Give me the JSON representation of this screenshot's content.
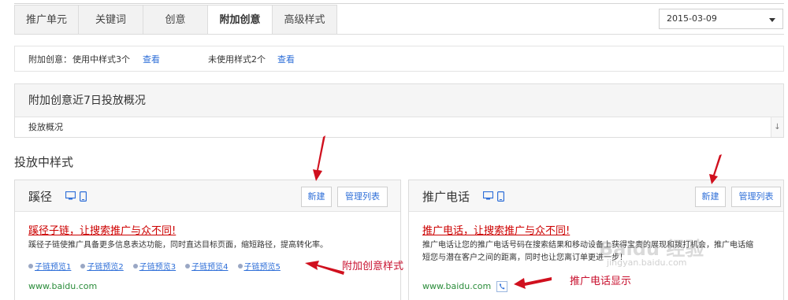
{
  "tabs": [
    "推广单元",
    "关键词",
    "创意",
    "附加创意",
    "高级样式"
  ],
  "active_tab": "附加创意",
  "date_select": {
    "value": "2015-03-09"
  },
  "info": {
    "using_label": "附加创意：",
    "using_text": "使用中样式3个",
    "using_link": "查看",
    "unused_text": "未使用样式2个",
    "unused_link": "查看"
  },
  "overview": {
    "title": "附加创意近7日投放概况",
    "row_label": "投放概况",
    "toggle_icon": "↓"
  },
  "section_title": "投放中样式",
  "cards": [
    {
      "title": "蹊径",
      "new_button": "新建",
      "manage_button": "管理列表",
      "ad_title_prefix": "蹊径子链，让搜索",
      "ad_title_highlight": "推广",
      "ad_title_suffix": "与众不同!",
      "description": "蹊径子链使推广具备更多信息表达功能，同时直达目标页面，缩短路径，提高转化率。",
      "sublinks": [
        "子链预览1",
        "子链预览2",
        "子链预览3",
        "子链预览4",
        "子链预览5"
      ],
      "url": "www.baidu.com"
    },
    {
      "title": "推广电话",
      "new_button": "新建",
      "manage_button": "管理列表",
      "ad_title_prefix": "推广电话，让搜索",
      "ad_title_highlight": "推广",
      "ad_title_suffix": "与众不同!",
      "description_line1": "推广电话让您的推广电话号码在搜索结果和移动设备上获得宝贵的展现和拨打机会，推广电话缩",
      "description_line2": "短您与潜在客户之间的距离，同时也让您离订单更进一步！",
      "url": "www.baidu.com"
    }
  ],
  "annotations": {
    "extra_style": "附加创意样式",
    "phone_display": "推广电话显示"
  },
  "watermark": {
    "main": "Baidu 经验",
    "sub": "jingyan.baidu.com"
  },
  "colors": {
    "accent_link": "#2f6fd8",
    "annotation": "#c8102e",
    "ad_title": "#c00000",
    "url": "#2a8c3a"
  }
}
